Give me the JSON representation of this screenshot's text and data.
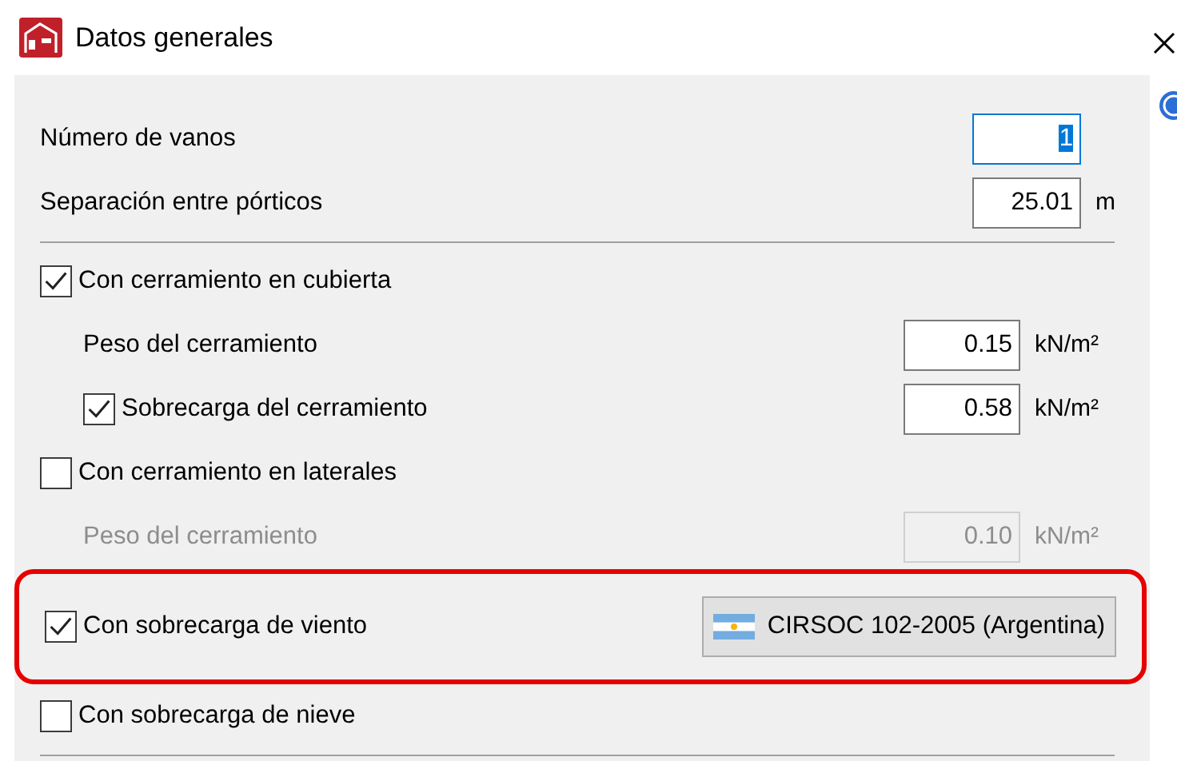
{
  "window": {
    "title": "Datos generales"
  },
  "rows": [
    {
      "kind": "field",
      "label": "Número de vanos",
      "value": "1",
      "focused": true,
      "unit": ""
    },
    {
      "kind": "field",
      "label": "Separación entre pórticos",
      "value": "25.01",
      "focused": false,
      "unit": "m"
    },
    {
      "kind": "divider"
    },
    {
      "kind": "check",
      "label": "Con cerramiento en cubierta",
      "checked": true,
      "children": [
        {
          "kind": "field",
          "label": "Peso del cerramiento",
          "value": "0.15",
          "focused": false,
          "disabled": false,
          "unit": "kN/m²"
        },
        {
          "kind": "check-field",
          "label": "Sobrecarga del cerramiento",
          "checked": true,
          "value": "0.58",
          "focused": false,
          "unit": "kN/m²"
        }
      ]
    },
    {
      "kind": "check",
      "label": "Con cerramiento en laterales",
      "checked": false,
      "children": [
        {
          "kind": "field",
          "label": "Peso del cerramiento",
          "value": "0.10",
          "focused": false,
          "disabled": true,
          "unit": "kN/m²"
        }
      ]
    },
    {
      "kind": "check",
      "label": "Con sobrecarga de viento",
      "checked": true,
      "highlighted": true,
      "button": "CIRSOC 102-2005 (Argentina)"
    },
    {
      "kind": "check",
      "label": "Con sobrecarga de nieve",
      "checked": false
    },
    {
      "kind": "divider"
    }
  ]
}
